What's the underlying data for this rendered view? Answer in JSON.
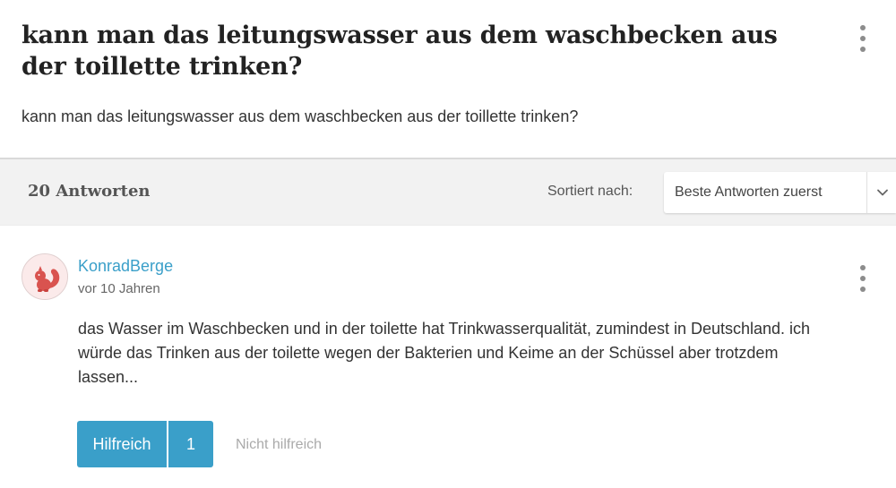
{
  "question": {
    "title": "kann man das leitungswasser aus dem waschbecken aus der toillette trinken?",
    "body": "kann man das leitungswasser aus dem waschbecken aus der toillette trinken?"
  },
  "answers_bar": {
    "count_label": "20 Antworten",
    "sort_label": "Sortiert nach:",
    "sort_value": "Beste Antworten zuerst"
  },
  "answer": {
    "author": "KonradBerge",
    "date": "vor 10 Jahren",
    "text": "das Wasser im Waschbecken und in der toilette hat Trinkwasserqualität, zumindest in Deutschland. ich würde das Trinken aus der toilette wegen der Bakterien und Keime an der Schüssel aber trotzdem lassen...",
    "helpful_label": "Hilfreich",
    "helpful_count": "1",
    "not_helpful_label": "Nicht hilfreich"
  },
  "colors": {
    "accent": "#3a9fc9",
    "avatar_squirrel": "#d9534f"
  },
  "icons": {
    "question_menu": "kebab-menu-icon",
    "answer_menu": "kebab-menu-icon",
    "sort_chevron": "chevron-down-icon",
    "avatar": "squirrel-avatar"
  }
}
